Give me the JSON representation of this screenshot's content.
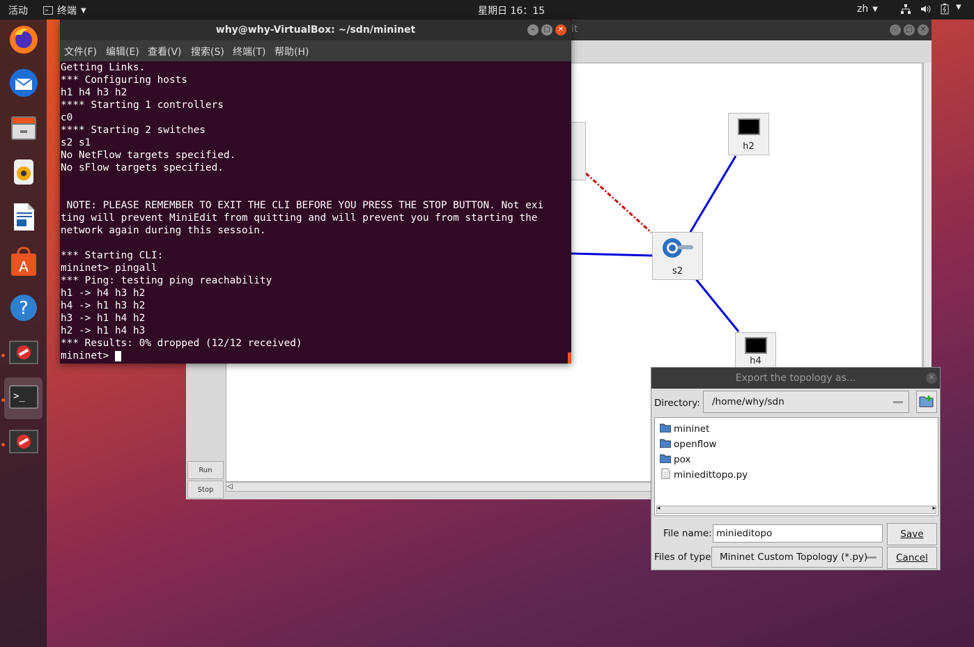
{
  "topbar": {
    "activities": "活动",
    "app_name": "终端",
    "clock": "星期日 16：15",
    "input_method": "zh"
  },
  "dock": {
    "apps": [
      "firefox",
      "thunderbird",
      "files",
      "rhythmbox",
      "writer",
      "software",
      "help",
      "miniedit",
      "terminal",
      "miniedit-2"
    ]
  },
  "miniedit": {
    "title_fragment": "it",
    "buttons": {
      "run": "Run",
      "stop": "Stop"
    },
    "nodes": {
      "h2": "h2",
      "s2": "s2",
      "h4": "h4"
    }
  },
  "terminal": {
    "title": "why@why-VirtualBox: ~/sdn/mininet",
    "menu": [
      "文件(F)",
      "编辑(E)",
      "查看(V)",
      "搜索(S)",
      "终端(T)",
      "帮助(H)"
    ],
    "lines": [
      "Getting Links.",
      "*** Configuring hosts",
      "h1 h4 h3 h2",
      "**** Starting 1 controllers",
      "c0",
      "**** Starting 2 switches",
      "s2 s1",
      "No NetFlow targets specified.",
      "No sFlow targets specified.",
      "",
      "",
      " NOTE: PLEASE REMEMBER TO EXIT THE CLI BEFORE YOU PRESS THE STOP BUTTON. Not exi",
      "ting will prevent MiniEdit from quitting and will prevent you from starting the",
      "network again during this sessoin.",
      "",
      "*** Starting CLI:",
      "mininet> pingall",
      "*** Ping: testing ping reachability",
      "h1 -> h4 h3 h2",
      "h4 -> h1 h3 h2",
      "h3 -> h1 h4 h2",
      "h2 -> h1 h4 h3",
      "*** Results: 0% dropped (12/12 received)",
      "mininet> "
    ]
  },
  "dialog": {
    "title": "Export the topology as...",
    "directory_label": "Directory:",
    "directory_value": "/home/why/sdn",
    "files": [
      {
        "name": "mininet",
        "type": "folder"
      },
      {
        "name": "openflow",
        "type": "folder"
      },
      {
        "name": "pox",
        "type": "folder"
      },
      {
        "name": "miniedittopo.py",
        "type": "file"
      }
    ],
    "filename_label": "File name:",
    "filename_value": "minieditopo",
    "filetype_label": "Files of type:",
    "filetype_value": "Mininet Custom Topology (*.py)",
    "save": "Save",
    "cancel": "Cancel"
  }
}
